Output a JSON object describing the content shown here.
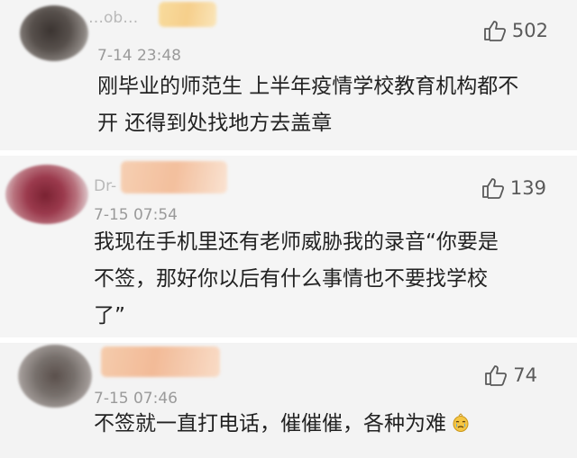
{
  "comments": [
    {
      "username": "…ob…",
      "timestamp": "7-14 23:48",
      "likes": "502",
      "text": "刚毕业的师范生 上半年疫情学校教育机构都不\n开 还得到处找地方去盖章"
    },
    {
      "username": "Dr-",
      "timestamp": "7-15 07:54",
      "likes": "139",
      "text": "我现在手机里还有老师威胁我的录音“你要是\n不签，那好你以后有什么事情也不要找学校\n了”"
    },
    {
      "username": "",
      "timestamp": "7-15 07:46",
      "likes": "74",
      "text": "不签就一直打电话，催催催，各种为难",
      "emoji": "crying-face-icon"
    }
  ],
  "colors": {
    "text": "#222222",
    "meta": "#9a9a9a",
    "card": "#f4f4f4"
  }
}
